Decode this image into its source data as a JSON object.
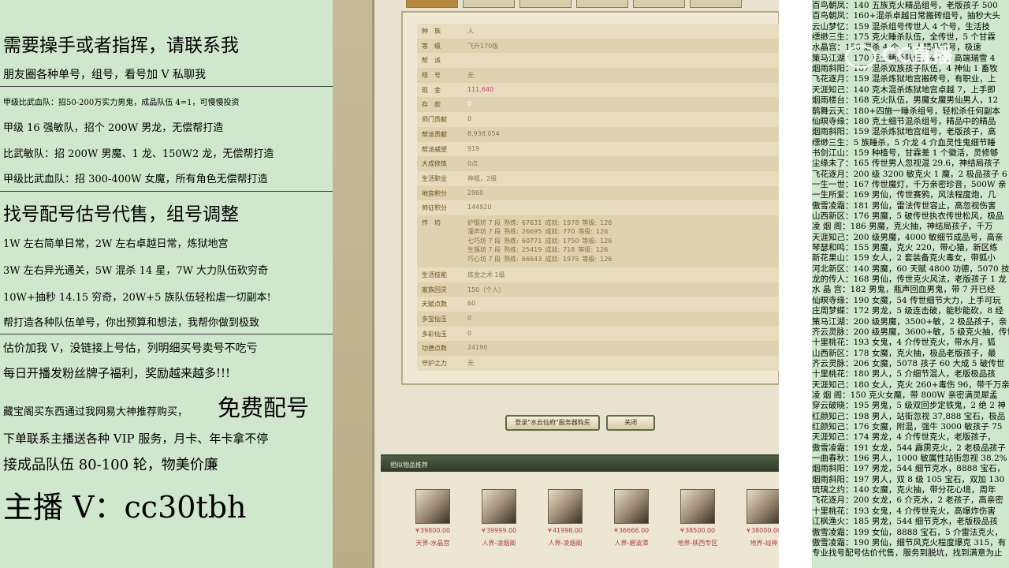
{
  "left_panel": {
    "lines": [
      "需要操手或者指挥，请联系我",
      "朋友圈各种单号，组号，看号加 V 私聊我",
      "甲级比武血队：招50-200万实力男鬼，成品队伍 4=1，可慢慢投资",
      "甲级 16 强敏队，招个 200W 男龙，无偿帮打造",
      "比武敏队：招 200W 男魔、1 龙、150W2 龙，无偿帮打造",
      "甲级比武血队：招 300-400W 女魔，所有角色无偿帮打造",
      "找号配号估号代售，组号调整",
      "1W 左右简单日常，2W 左右卓越日常，炼狱地宫",
      "3W 左右异光通关，5W 混杀 14 星，7W 大力队伍砍穷奇",
      "10W+抽秒 14.15 穷奇，20W+5 族队伍轻松虐一切副本!",
      "帮打造各种队伍单号，你出预算和想法，我帮你做到极致",
      "估价加我 V，没链接上号估，列明细买号卖号不吃亏",
      "每日开播发粉丝牌子福利，奖励越来越多!!!",
      "藏宝阁买东西通过我网易大神推荐购买，",
      "免费配号",
      "下单联系主播送各种 VIP 服务，月卡、年卡拿不停",
      "接成品队伍 80-100 轮，物美价廉",
      "主播 V：cc30tbh"
    ]
  },
  "game": {
    "info": [
      {
        "key": "种　族",
        "value": "人"
      },
      {
        "key": "等　级",
        "value": "飞升170级"
      },
      {
        "key": "帮　派",
        "value": ""
      },
      {
        "key": "规　号",
        "value": "无"
      },
      {
        "key": "现　金",
        "value": "111,640",
        "style": "pink"
      },
      {
        "key": "存　款",
        "value": "0",
        "style": "white"
      },
      {
        "key": "师门贡献",
        "value": "0"
      },
      {
        "key": "帮派贡献",
        "value": "8,938,054"
      },
      {
        "key": "帮派威望",
        "value": "919"
      },
      {
        "key": "大成修炼",
        "value": "0点"
      },
      {
        "key": "生活职业",
        "value": "神祖，2级"
      },
      {
        "key": "地宫积分",
        "value": "2960"
      },
      {
        "key": "帅征积分",
        "value": "144920"
      }
    ],
    "workshop_label": "作　坊",
    "workshops": [
      {
        "name": "炉锻坊 7 段",
        "prof_label": "熟练:",
        "prof": "67631",
        "fame_label": "成就:",
        "fame": "1978",
        "lvl_label": "等级:",
        "lvl": "126"
      },
      {
        "name": "灌声坊 7 段",
        "prof_label": "熟练:",
        "prof": "26695",
        "fame_label": "成就:",
        "fame": "770",
        "lvl_label": "等级:",
        "lvl": "126"
      },
      {
        "name": "七巧坊 7 段",
        "prof_label": "熟练:",
        "prof": "60771",
        "fame_label": "成就:",
        "fame": "1750",
        "lvl_label": "等级:",
        "lvl": "126"
      },
      {
        "name": "生簇坊 7 段",
        "prof_label": "熟练:",
        "prof": "25419",
        "fame_label": "成就:",
        "fame": "718",
        "lvl_label": "等级:",
        "lvl": "126"
      },
      {
        "name": "巧心坊 7 段",
        "prof_label": "熟练:",
        "prof": "66643",
        "fame_label": "成就:",
        "fame": "1975",
        "lvl_label": "等级:",
        "lvl": "126"
      }
    ],
    "info2": [
      {
        "key": "生活技能",
        "value": "炼金之术 1级"
      },
      {
        "key": "家族回灵",
        "value": "150（个人）"
      },
      {
        "key": "天赋点数",
        "value": "60"
      },
      {
        "key": "多宝仙玉",
        "value": "0"
      },
      {
        "key": "多彩仙玉",
        "value": "0"
      },
      {
        "key": "功德点数",
        "value": "24190"
      },
      {
        "key": "守护之力",
        "value": "无"
      }
    ],
    "buttons": {
      "login": "登录\"水云仙府\"服务器购买",
      "close": "关闭"
    },
    "rec_title": "相似物品推荐",
    "price_symbol": "¥",
    "rec_items": [
      {
        "price": "39800.00",
        "name": "天界-水晶宫"
      },
      {
        "price": "39999.00",
        "name": "人界-凌烟阁"
      },
      {
        "price": "41998.00",
        "name": "人界-凌烟阁"
      },
      {
        "price": "36666.00",
        "name": "人界-碧波潭"
      },
      {
        "price": "38500.00",
        "name": "地界-陕西专区"
      },
      {
        "price": "38000.00",
        "name": "地界-战神"
      }
    ]
  },
  "right_panel": {
    "watermark": "CC直播",
    "lines": [
      "百鸟朝凤：140 五族克火精品组号，老版孩子 500",
      "百鸟朝凤：160+混杀卓越日常搬砖组号，抽秒大头",
      "云山梦忆：159 混杀组号传世人 4 个号，生活技",
      "缥缈三生：175 克火睡杀队伍，全传世，5 个甘霖",
      "水晶宫：150 混杀 4 个，5 人精品组号，极速",
      "策马江湖：170 克土睡杀队伍，4 个，高端瑞雪 4",
      "烟雨斜阳：167 混杀双族孩子队伍，4 神仙 1 畜牧",
      "飞花逐月：159 混杀炼狱地宫搬砖号，有职业，上",
      "天涯知己：140 克木混杀炼狱地宫卓越 7，上手即",
      "烟雨楼台：168 克火队伍，男魔女魔男仙男人，12",
      "鹊舞云天：180+四施一睡杀组号，轻松杀任何副本",
      "仙暝寺缘：180 克土细节混杀组号，精品中的精品",
      "烟雨斜阳：159 混杀炼狱地宫组号，老版孩子，高",
      "缥缈三生：5 族睡杀，5 介龙 4 介血灵性鬼细节睡",
      "书剑江山：159 种植号，甘霖差 1 个徽活，灵修够",
      "尘缘未了：165 传世男人忽视混 29.6，神结局孩子",
      "飞花逐月：200 级 3200 敏克火 1 魔，2 极品孩子 6",
      "一生一世：167 传世魔灯，千万亲密珍音，500W 亲",
      "一生所爱：169 男仙，传世赛鸦，风法程度炮，几",
      "傲雪凌霜：181 男仙，雷法传世容止，高忽视伤害",
      "山西新区：176 男魔，5 破传世执衣传世松风，极品",
      "凌 烟 阁：186 男魔，克火抽，神结局孩子，千万",
      "天涯知己：200 级男魔，4000 敏细节成品号，高亲",
      "琴瑟和鸣：155 男魔，克火 220，带心猿，新区练",
      "新花果山：159 女人，2 套装备克火毒女，带狐小",
      "河北新区：140 男魔，60 天赋 4800 功德，5070 技",
      "龙的传人：168 男仙，传世克火风法，老版孩子 1 龙",
      "水 晶 宫：182 男鬼，瓶声回血男鬼，带 7 开已经",
      "仙暝寺缘：190 女魔，54 传世细节大力，上手可玩",
      "庄周梦蝶：172 男龙，5 级连击破，能秒能砍，8 经",
      "策马江湖：200 级男魔，3500+敏，2 极品孩子，亲",
      "齐云灵脉：200 级男魔，3600+敏，5 级克火抽，传世",
      "十里桃花：193 女鬼，4 介传世克火，带水月，狐",
      "山西新区：178 女魔，克火抽，极品老版孩子，最",
      "齐云灵脉：206 女魔，5078 孩子 60 大成 5 破传世",
      "十里桃花：180 男人，5 介细节混人，老版极品孩",
      "天涯知己：180 女人，克火 260+毒伤 96，带千万亲",
      "凌 烟 阁：150 克火女魔，带 800W 亲密满灵犀孟",
      "穿云破晓：195 男鬼，5 级双回步定铁鬼，2 绝 2 神",
      "红颜知己：198 男人，站街忽视 37,888 宝石，极品",
      "红颜知己：176 女魔，附混，强牛 3000 敏孩子 75",
      "天涯知己：174 男龙，4 介传世克火，老版孩子，",
      "傲雪凌霜：191 女龙，544 霹雳克火，2 老极品孩子",
      "一曲春秋：196 男人，1000 敏属性站街忽视 38.2%",
      "烟雨斜阳：197 男龙，544 细节克水，8888 宝石，",
      "烟雨斜阳：197 男人，双 8 级 105 宝石，双加 130",
      "琉璃之约：140 女魔，克火抽，带分花心境，周年",
      "飞花逐月：200 女龙，6 介克水，2 老孩子，高亲密",
      "十里桃花：193 女鬼，4 介传世克火，高爆炸伤害",
      "江枫渔火：185 男龙，544 细节克水，老版极品孩",
      "傲雪凌霜：199 女仙，8888 宝石，5 介雷法克火，",
      "傲雪凌霜：190 男仙，细节风克火程度爆克 315，有",
      "专业找号配号估价代售，服务到脱坑，找到满意为止"
    ]
  }
}
